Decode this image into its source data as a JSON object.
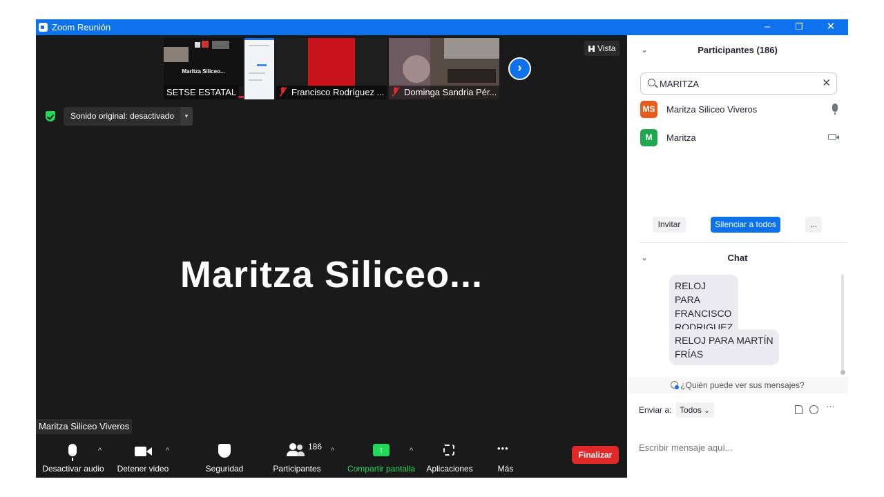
{
  "window": {
    "title": "Zoom Reunión",
    "controls": {
      "minimize": "–",
      "restore": "❐",
      "close": "✕"
    }
  },
  "thumbnails": [
    {
      "label": "SETSE ESTATAL",
      "muted": false,
      "inner_text": "Maritza Siliceo..."
    },
    {
      "label": "Francisco Rodríguez ...",
      "muted": true
    },
    {
      "label": "Dominga Sandria Pér...",
      "muted": true
    }
  ],
  "stage": {
    "next_icon": "›",
    "view_button": "Vista",
    "view_icon": "grid-icon",
    "original_sound": "Sonido original: desactivado",
    "original_sound_caret": "▾",
    "active_speaker": "Maritza  Siliceo...",
    "name_tag": "Maritza Siliceo Viveros"
  },
  "toolbar": {
    "audio": "Desactivar audio",
    "video": "Detener video",
    "security": "Seguridad",
    "participants": "Participantes",
    "participants_count": "186",
    "share": "Compartir pantalla",
    "apps": "Aplicaciones",
    "more": "Más",
    "more_icon": "•••",
    "end": "Finalizar",
    "caret": "^"
  },
  "participants_panel": {
    "title": "Participantes (186)",
    "collapse_icon": "⌄",
    "search_value": "MARITZA",
    "clear_icon": "✕",
    "list": [
      {
        "initials": "MS",
        "name": "Maritza Siliceo Viveros",
        "color": "#e55c1c",
        "status_icon": "mic-icon"
      },
      {
        "initials": "M",
        "name": "Maritza",
        "color": "#20a84f",
        "status_icon": "camera-icon"
      }
    ],
    "invite": "Invitar",
    "mute_all": "Silenciar a todos",
    "more": "..."
  },
  "chat": {
    "title": "Chat",
    "messages": [
      "RELOJ PARA\nFRANCISCO\nRODRIGUEZ",
      "RELOJ PARA MARTÍN\nFRÍAS"
    ],
    "who_can_see": "¿Quién puede ver sus mensajes?",
    "send_to_label": "Enviar a:",
    "send_to_value": "Todos",
    "send_to_caret": "⌄",
    "more_icon": "···",
    "input_placeholder": "Escribir mensaje aquí..."
  },
  "colors": {
    "accent": "#0e72ed",
    "end_button": "#e02828",
    "share_green": "#23d959"
  }
}
